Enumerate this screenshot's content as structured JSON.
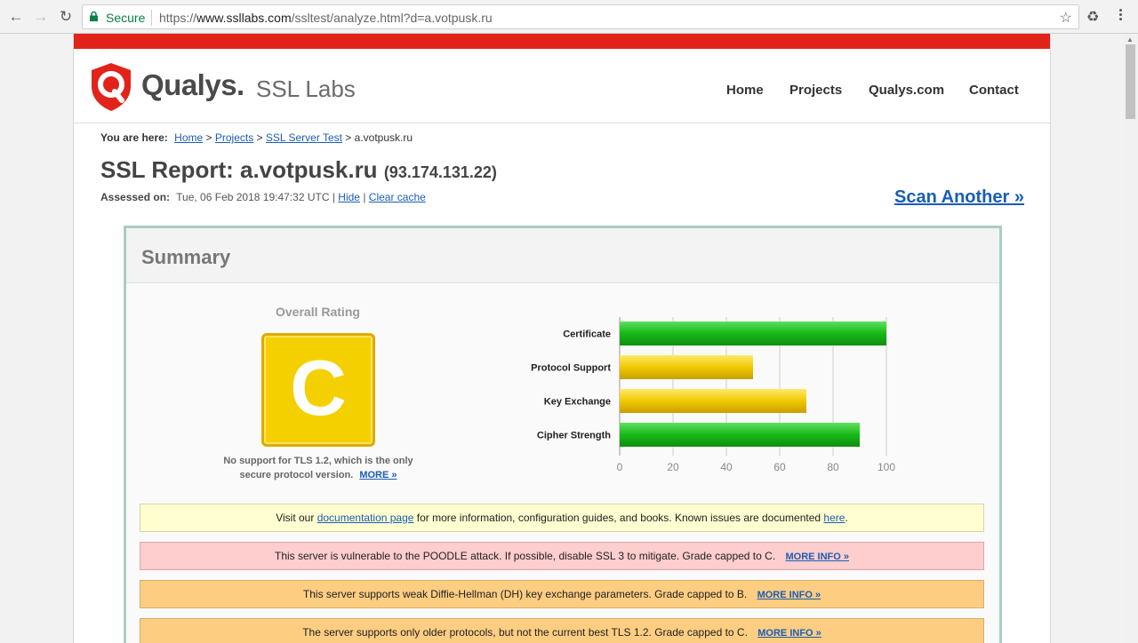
{
  "browser": {
    "back_icon": "back-arrow-icon",
    "secure_label": "Secure",
    "url_scheme": "https://",
    "url_host": "www.ssllabs.com",
    "url_path": "/ssltest/analyze.html?d=a.votpusk.ru"
  },
  "header": {
    "logo_text": "Qualys.",
    "logo_sub": "SSL Labs",
    "nav": [
      "Home",
      "Projects",
      "Qualys.com",
      "Contact"
    ]
  },
  "breadcrumb": {
    "prefix": "You are here:",
    "items": [
      "Home",
      "Projects",
      "SSL Server Test"
    ],
    "current": "a.votpusk.ru"
  },
  "report": {
    "title": "SSL Report: a.votpusk.ru",
    "ip": "(93.174.131.22)",
    "assessed_label": "Assessed on:",
    "assessed_value": "Tue, 06 Feb 2018 19:47:32 UTC",
    "hide": "Hide",
    "clear_cache": "Clear cache",
    "scan_another": "Scan Another »"
  },
  "summary": {
    "title": "Summary",
    "rating_label": "Overall Rating",
    "grade": "C",
    "grade_note": "No support for TLS 1.2, which is the only secure protocol version.",
    "grade_more": "MORE »"
  },
  "notices": {
    "doc_pre": "Visit our",
    "doc_link": "documentation page",
    "doc_post": "for more information, configuration guides, and books. Known issues are documented",
    "doc_here": "here",
    "poodle": "This server is vulnerable to the POODLE attack. If possible, disable SSL 3 to mitigate. Grade capped to C.",
    "dh": "This server supports weak Diffie-Hellman (DH) key exchange parameters. Grade capped to B.",
    "tls": "The server supports only older protocols, but not the current best TLS 1.2. Grade capped to C.",
    "more_info": "MORE INFO »"
  },
  "colors": {
    "green": "#18b818",
    "yellow": "#f0c800",
    "red_bar": "#e2231a"
  },
  "chart_data": {
    "type": "bar",
    "orientation": "horizontal",
    "categories": [
      "Certificate",
      "Protocol Support",
      "Key Exchange",
      "Cipher Strength"
    ],
    "values": [
      100,
      50,
      70,
      90
    ],
    "colors": [
      "#18b818",
      "#f0c800",
      "#f0c800",
      "#18b818"
    ],
    "xticks": [
      0,
      20,
      40,
      60,
      80,
      100
    ],
    "xlim": [
      0,
      100
    ],
    "grid": true
  }
}
